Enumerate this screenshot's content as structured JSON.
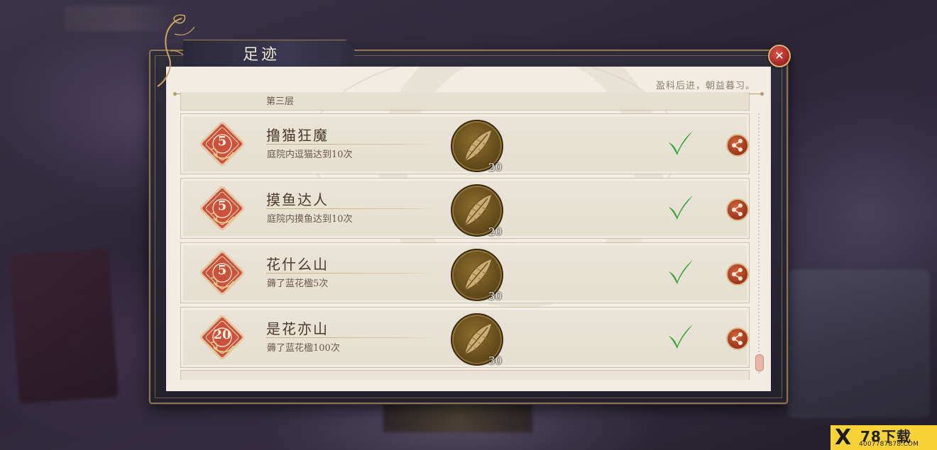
{
  "dialog": {
    "title": "足迹",
    "motto": "盈科后进，朝益暮习。",
    "close_icon": "close-icon"
  },
  "partial_top_row": {
    "label": "第三层"
  },
  "achievements": [
    {
      "badge": "5",
      "name": "撸猫狂魔",
      "desc": "庭院内逗猫达到10次",
      "reward_icon": "feather-icon",
      "reward_count": "20",
      "completed": true
    },
    {
      "badge": "5",
      "name": "摸鱼达人",
      "desc": "庭院内摸鱼达到10次",
      "reward_icon": "feather-icon",
      "reward_count": "20",
      "completed": true
    },
    {
      "badge": "5",
      "name": "花什么山",
      "desc": "薅了蓝花楹5次",
      "reward_icon": "feather-icon",
      "reward_count": "30",
      "completed": true
    },
    {
      "badge": "20",
      "name": "是花亦山",
      "desc": "薅了蓝花楹100次",
      "reward_icon": "feather-icon",
      "reward_count": "30",
      "completed": true
    }
  ],
  "watermark": {
    "mark": "X",
    "big": "78下载",
    "small": "4007787878.COM"
  },
  "colors": {
    "accent_gold": "#b49a6c",
    "badge_red": "#c9513d",
    "check_green": "#3aa33a",
    "panel_bg": "#f1ece4"
  }
}
